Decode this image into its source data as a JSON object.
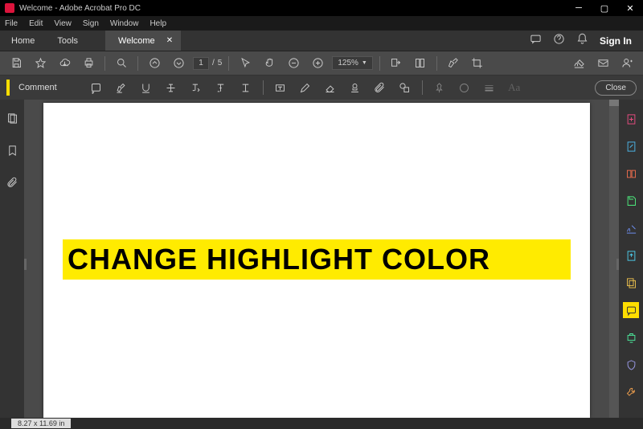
{
  "window": {
    "title": "Welcome - Adobe Acrobat Pro DC"
  },
  "menu": {
    "file": "File",
    "edit": "Edit",
    "view": "View",
    "sign": "Sign",
    "window": "Window",
    "help": "Help"
  },
  "tabs": {
    "home": "Home",
    "tools": "Tools",
    "doc": "Welcome",
    "signin": "Sign In"
  },
  "page": {
    "current": "1",
    "sep": "/",
    "total": "5"
  },
  "zoom": {
    "value": "125%"
  },
  "comment": {
    "label": "Comment",
    "close": "Close"
  },
  "content": {
    "highlighted": "CHANGE HIGHLIGHT COLOR"
  },
  "status": {
    "dims": "8.27 x 11.69 in"
  },
  "colors": {
    "r1": "#ec4d82",
    "r2": "#4db8ec",
    "r3": "#ec6d4d",
    "r4": "#4dec7d",
    "r5": "#6d8dec",
    "r6": "#4dccec",
    "r7": "#ecc04d",
    "r8": "#ffde00",
    "r9": "#4dec9d",
    "r10": "#9d9dec",
    "r11": "#ec9d4d"
  }
}
